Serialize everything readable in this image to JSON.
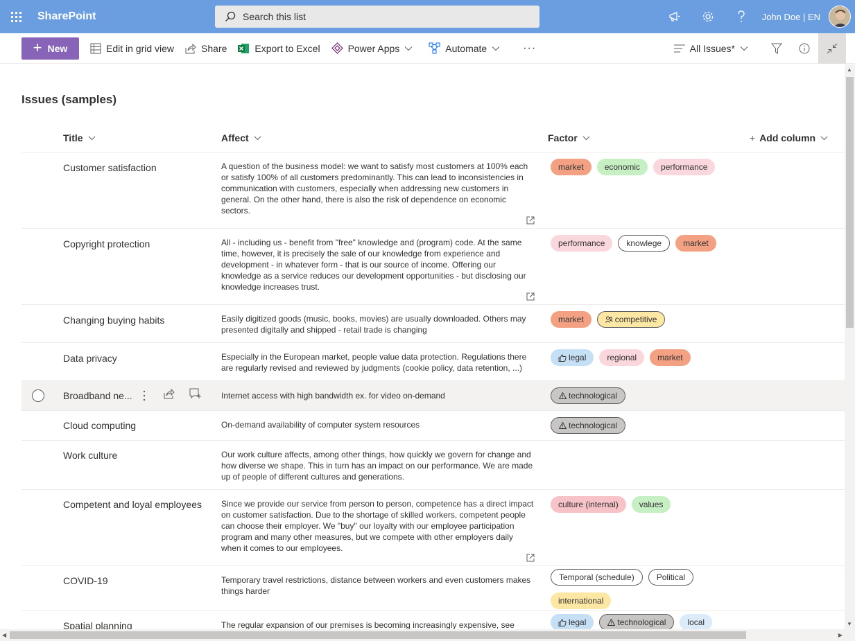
{
  "suite": {
    "app_name": "SharePoint",
    "search_placeholder": "Search this list",
    "user_label": "John Doe | EN"
  },
  "commands": {
    "new_label": "New",
    "edit_grid_label": "Edit in grid view",
    "share_label": "Share",
    "export_label": "Export to Excel",
    "powerapps_label": "Power Apps",
    "automate_label": "Automate",
    "more_label": "···",
    "view_label": "All Issues*"
  },
  "list": {
    "title": "Issues (samples)",
    "columns": {
      "title": "Title",
      "affect": "Affect",
      "factor": "Factor",
      "add_column": "Add column"
    },
    "rows": [
      {
        "title": "Customer satisfaction",
        "affect": "A question of the business model: we want to satisfy most customers at 100% each or satisfy 100% of all customers predominantly. This can lead to inconsistencies in communication with customers, especially when addressing new customers in general. On the other hand, there is also the risk of dependence on economic sectors.",
        "tags": [
          "market",
          "economic",
          "performance"
        ]
      },
      {
        "title": "Copyright protection",
        "affect": "All - including us - benefit from \"free\" knowledge and (program) code. At the same time, however, it is precisely the sale of our knowledge from experience and development - in whatever form - that is our source of income. Offering our knowledge as a service reduces our development opportunities - but disclosing our knowledge increases trust.",
        "tags": [
          "performance",
          "knowlege",
          "market"
        ]
      },
      {
        "title": "Changing buying habits",
        "affect": "Easily digitized goods (music, books, movies) are usually downloaded. Others may presented digitally and shipped - retail trade is changing",
        "tags": [
          "market",
          "competitive"
        ]
      },
      {
        "title": "Data privacy",
        "affect": "Especially in the European market, people value data protection. Regulations there are regularly revised and reviewed by judgments (cookie policy, data retention, ...)",
        "tags": [
          "legal",
          "regional",
          "market"
        ]
      },
      {
        "title": "Broadband ne...",
        "affect": "Internet access with high bandwidth ex. for video on-demand",
        "tags": [
          "technological"
        ]
      },
      {
        "title": "Cloud computing",
        "affect": "On-demand availability of computer system resources",
        "tags": [
          "technological"
        ]
      },
      {
        "title": "Work culture",
        "affect": "Our work culture affects, among other things, how quickly we govern for change and how diverse we shape. This in turn has an impact on our performance. We are made up of people of different cultures and generations.",
        "tags": []
      },
      {
        "title": "Competent and loyal employees",
        "affect": "Since we provide our service from person to person, competence has a direct impact on customer satisfaction. Due to the shortage of skilled workers, competent people can choose their employer. We \"buy\" our loyalty with our employee participation program and many other measures, but we compete with other employers daily when it comes to our employees.",
        "tags": [
          "culture (internal)",
          "values"
        ]
      },
      {
        "title": "COVID-19",
        "affect": "Temporary travel restrictions, distance between workers and even customers makes things harder",
        "tags": [
          "Temporal (schedule)",
          "Political",
          "international"
        ]
      },
      {
        "title": "Spatial planning",
        "affect": "The regular expansion of our premises is becoming increasingly expensive, see",
        "tags": [
          "legal",
          "technological",
          "local"
        ]
      }
    ]
  },
  "colors": {
    "suite_bar": "#6a9ee0",
    "new_button": "#8764b8",
    "market": "#f4a183",
    "economic": "#c6efc4",
    "performance": "#fad7dc"
  }
}
